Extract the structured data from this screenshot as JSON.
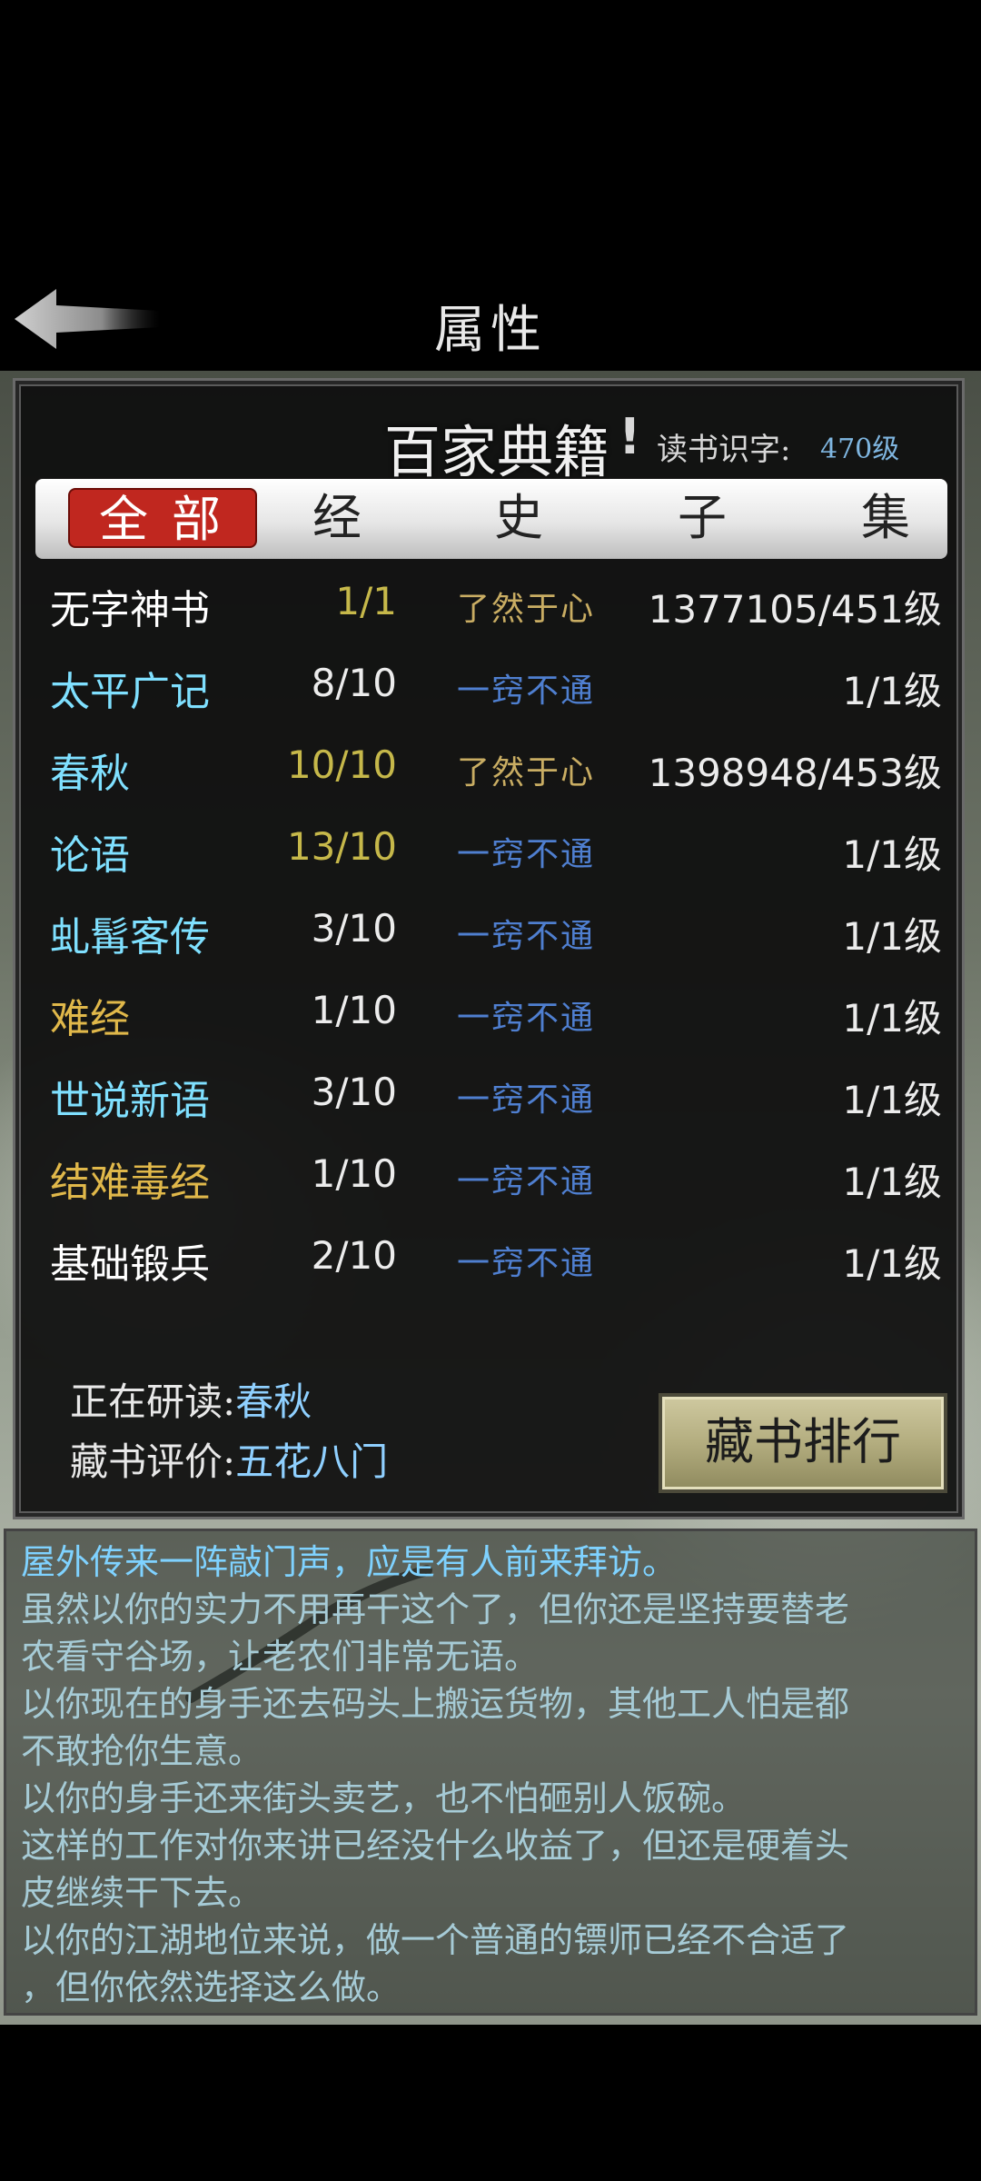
{
  "header": {
    "title": "属性"
  },
  "panel": {
    "title": "百家典籍",
    "exclamation": "!",
    "level_label": "读书识字:",
    "level_value": "470级"
  },
  "tabs": [
    {
      "label": "全部",
      "active": true
    },
    {
      "label": "经",
      "active": false
    },
    {
      "label": "史",
      "active": false
    },
    {
      "label": "子",
      "active": false
    },
    {
      "label": "集",
      "active": false
    }
  ],
  "books": [
    {
      "name": "无字神书",
      "progress": "1/1",
      "status": "了然于心",
      "level": "1377105/451级",
      "name_color": "#ffffff",
      "progress_color": "#c6b84a",
      "status_color": "#c9ad63"
    },
    {
      "name": "太平广记",
      "progress": "8/10",
      "status": "一窍不通",
      "level": "1/1级",
      "name_color": "#7fe0ff",
      "progress_color": "#ececec",
      "status_color": "#4f7fd0"
    },
    {
      "name": "春秋",
      "progress": "10/10",
      "status": "了然于心",
      "level": "1398948/453级",
      "name_color": "#7fe0ff",
      "progress_color": "#c6b84a",
      "status_color": "#c9ad63"
    },
    {
      "name": "论语",
      "progress": "13/10",
      "status": "一窍不通",
      "level": "1/1级",
      "name_color": "#7fe0ff",
      "progress_color": "#c6b84a",
      "status_color": "#4f7fd0"
    },
    {
      "name": "虬髯客传",
      "progress": "3/10",
      "status": "一窍不通",
      "level": "1/1级",
      "name_color": "#7fe0ff",
      "progress_color": "#ececec",
      "status_color": "#4f7fd0"
    },
    {
      "name": "难经",
      "progress": "1/10",
      "status": "一窍不通",
      "level": "1/1级",
      "name_color": "#e0b84a",
      "progress_color": "#ececec",
      "status_color": "#4f7fd0"
    },
    {
      "name": "世说新语",
      "progress": "3/10",
      "status": "一窍不通",
      "level": "1/1级",
      "name_color": "#7fe0ff",
      "progress_color": "#ececec",
      "status_color": "#4f7fd0"
    },
    {
      "name": "结难毒经",
      "progress": "1/10",
      "status": "一窍不通",
      "level": "1/1级",
      "name_color": "#e0b84a",
      "progress_color": "#ececec",
      "status_color": "#4f7fd0"
    },
    {
      "name": "基础锻兵",
      "progress": "2/10",
      "status": "一窍不通",
      "level": "1/1级",
      "name_color": "#ffffff",
      "progress_color": "#ececec",
      "status_color": "#4f7fd0"
    }
  ],
  "footer": {
    "reading_label": "正在研读:",
    "reading_value": "春秋",
    "rating_label": "藏书评价:",
    "rating_value": "五花八门",
    "rank_button": "藏书排行"
  },
  "log": [
    "屋外传来一阵敲门声，应是有人前来拜访。",
    "虽然以你的实力不用再干这个了，但你还是坚持要替老",
    "农看守谷场，让老农们非常无语。",
    "以你现在的身手还去码头上搬运货物，其他工人怕是都",
    "不敢抢你生意。",
    "以你的身手还来街头卖艺，也不怕砸别人饭碗。",
    "这样的工作对你来讲已经没什么收益了，但还是硬着头",
    "皮继续干下去。",
    "以你的江湖地位来说，做一个普通的镖师已经不合适了",
    "，但你依然选择这么做。"
  ]
}
